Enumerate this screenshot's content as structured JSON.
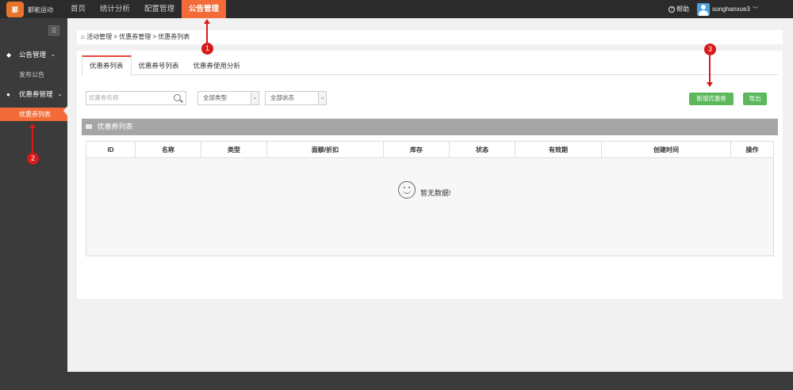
{
  "brand": {
    "logo_text": "鄞能运动",
    "mark": "鄞"
  },
  "topnav": {
    "items": [
      {
        "label": "首页",
        "active": false
      },
      {
        "label": "统计分析",
        "active": false
      },
      {
        "label": "配置管理",
        "active": false
      },
      {
        "label": "公告管理",
        "active": true
      }
    ]
  },
  "user": {
    "help_label": "帮助",
    "help_icon": "help-circle-icon",
    "username": "songhanxue3",
    "chevron": "chevron-down-icon"
  },
  "sidebar": {
    "toggle_icon": "menu-icon",
    "groups": [
      {
        "label": "公告管理",
        "icon": "tag-icon",
        "items": [
          {
            "label": "发布公告",
            "active": false
          }
        ]
      },
      {
        "label": "优惠券管理",
        "icon": "users-icon",
        "items": [
          {
            "label": "优惠券列表",
            "active": true
          }
        ]
      }
    ]
  },
  "breadcrumb": {
    "text": "活动管理 > 优惠券管理 > 优惠券列表",
    "icon": "home-icon"
  },
  "tabs": [
    {
      "label": "优惠券列表",
      "active": true
    },
    {
      "label": "优惠券号列表",
      "active": false
    },
    {
      "label": "优惠券使用分析",
      "active": false
    }
  ],
  "filters": {
    "search_placeholder": "优惠券名称",
    "type_select": "全部类型",
    "status_select": "全部状态"
  },
  "buttons": {
    "add_coupon": "新增优惠券",
    "export": "导出"
  },
  "section": {
    "title": "优惠券列表"
  },
  "table": {
    "columns": [
      "ID",
      "名称",
      "类型",
      "面额/折扣",
      "库存",
      "状态",
      "有效期",
      "创建时间",
      "操作"
    ],
    "rows": [],
    "empty_text": "暂无数据!"
  },
  "annotations": {
    "m1": "1",
    "m2": "2",
    "m3": "3"
  },
  "colors": {
    "accent": "#f36b38",
    "topbar": "#2b2b2b",
    "sidebar": "#3b3b3b",
    "green": "#5cb85c",
    "annotation": "#d71a1a"
  }
}
